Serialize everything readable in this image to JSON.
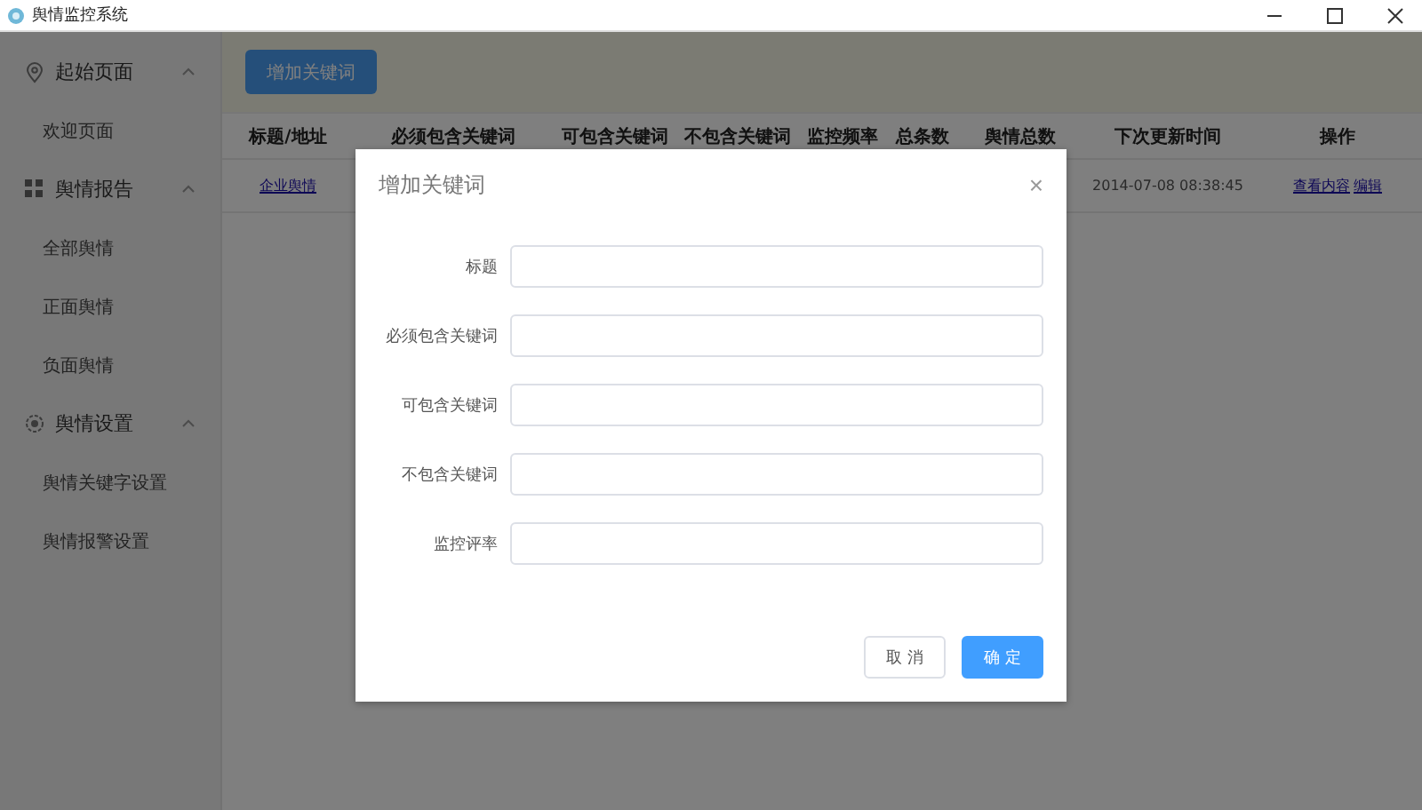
{
  "window": {
    "title": "舆情监控系统"
  },
  "sidebar": {
    "sections": [
      {
        "label": "起始页面",
        "expanded": true,
        "items": [
          "欢迎页面"
        ]
      },
      {
        "label": "舆情报告",
        "expanded": true,
        "items": [
          "全部舆情",
          "正面舆情",
          "负面舆情"
        ]
      },
      {
        "label": "舆情设置",
        "expanded": true,
        "items": [
          "舆情关键字设置",
          "舆情报警设置"
        ]
      }
    ]
  },
  "toolbar": {
    "add_button": "增加关键词"
  },
  "table": {
    "columns": [
      "标题/地址",
      "必须包含关键词",
      "可包含关键词",
      "不包含关键词",
      "监控频率",
      "总条数",
      "舆情总数",
      "下次更新时间",
      "操作"
    ],
    "rows": [
      {
        "title": "企业舆情",
        "next_update": "2014-07-08 08:38:45",
        "actions": [
          "查看内容",
          "编辑"
        ]
      }
    ]
  },
  "dialog": {
    "title": "增加关键词",
    "close": "×",
    "fields": [
      {
        "label": "标题"
      },
      {
        "label": "必须包含关键词"
      },
      {
        "label": "可包含关键词"
      },
      {
        "label": "不包含关键词"
      },
      {
        "label": "监控评率"
      }
    ],
    "buttons": [
      {
        "label": "取 消",
        "kind": "secondary"
      },
      {
        "label": "确 定",
        "kind": "primary"
      }
    ]
  }
}
